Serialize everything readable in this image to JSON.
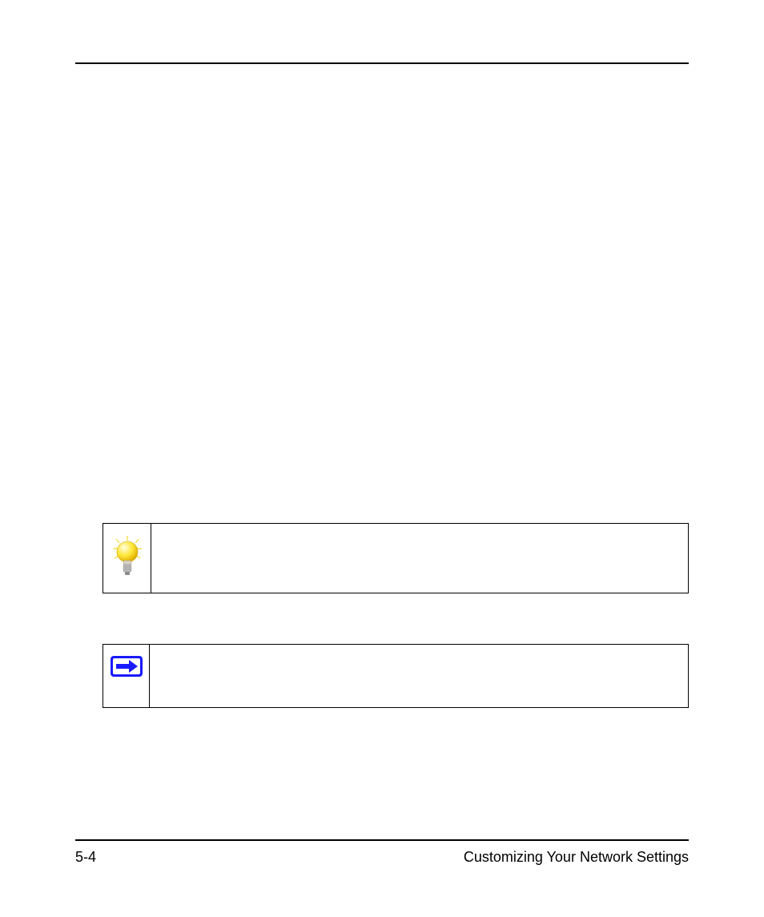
{
  "footer": {
    "page_number": "5-4",
    "section_title": "Customizing Your Network Settings"
  },
  "tip": {
    "icon": "lightbulb-icon",
    "text": ""
  },
  "note": {
    "icon": "arrow-right-icon",
    "text": ""
  }
}
